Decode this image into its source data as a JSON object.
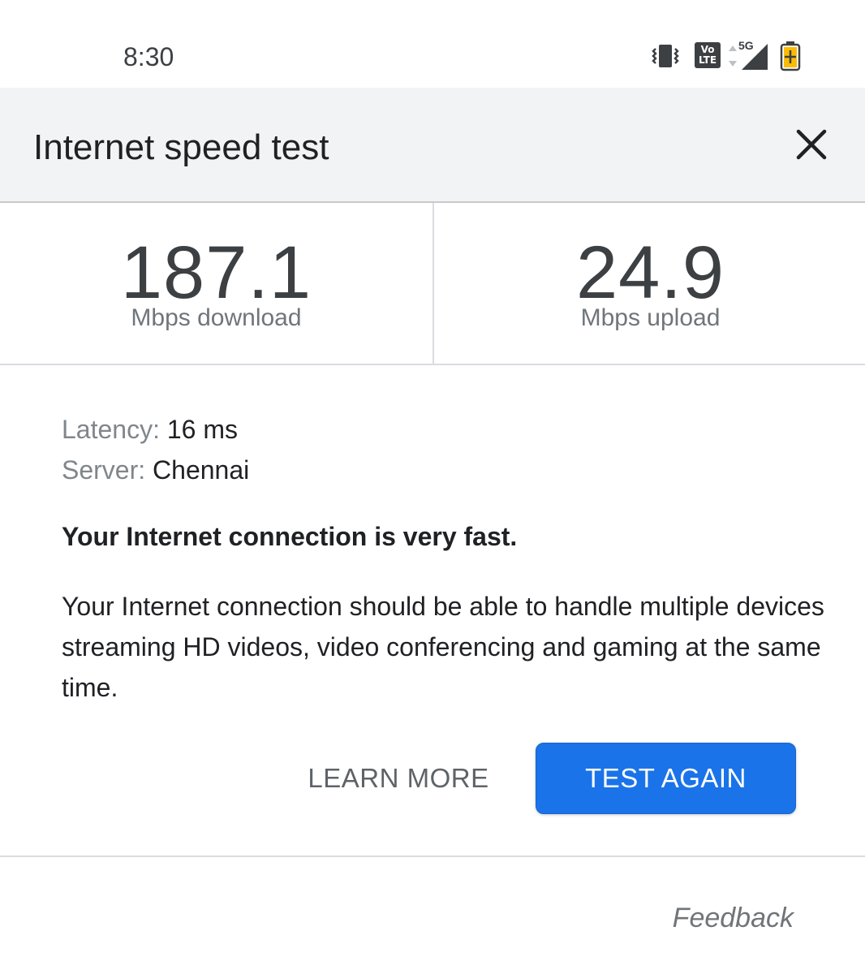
{
  "status_bar": {
    "time": "8:30",
    "icons": [
      "vibrate-icon",
      "volte-icon",
      "signal-5g-icon",
      "battery-charging-icon"
    ],
    "volte_top": "Vo",
    "volte_bottom": "LTE",
    "network": "5G"
  },
  "header": {
    "title": "Internet speed test",
    "close_icon": "close-icon"
  },
  "speed": {
    "download": {
      "value": "187.1",
      "unit": "Mbps download"
    },
    "upload": {
      "value": "24.9",
      "unit": "Mbps upload"
    }
  },
  "details": {
    "latency_label": "Latency:",
    "latency_value": "16 ms",
    "server_label": "Server:",
    "server_value": "Chennai"
  },
  "verdict": "Your Internet connection is very fast.",
  "description": "Your Internet connection should be able to handle multiple devices streaming HD videos, video conferencing and gaming at the same time.",
  "actions": {
    "learn_more": "LEARN MORE",
    "test_again": "TEST AGAIN"
  },
  "footer": {
    "feedback": "Feedback"
  },
  "colors": {
    "accent": "#1a73e8",
    "header_bg": "#f1f3f4",
    "divider": "#dadce0"
  }
}
